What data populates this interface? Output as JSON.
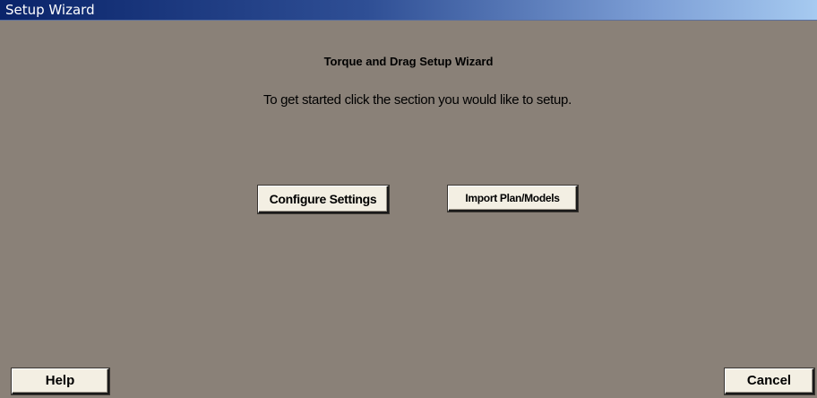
{
  "window": {
    "title": "Setup Wizard"
  },
  "main": {
    "heading": "Torque and Drag Setup Wizard",
    "instruction": "To get started click the section you would like to setup.",
    "buttons": {
      "configure_settings": "Configure Settings",
      "import_plan_models": "Import Plan/Models"
    }
  },
  "footer": {
    "help_label": "Help",
    "cancel_label": "Cancel"
  },
  "colors": {
    "background": "#8a8178",
    "titlebar_start": "#0a246a",
    "titlebar_end": "#a6caf0",
    "button_face": "#f3efe3"
  }
}
